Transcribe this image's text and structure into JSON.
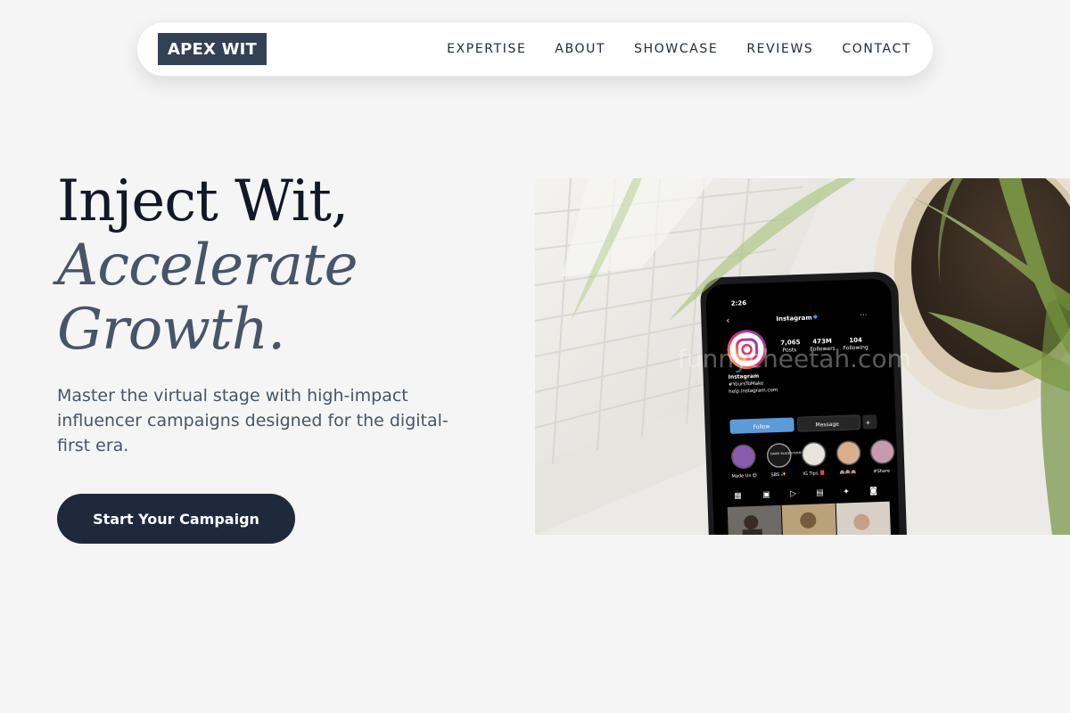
{
  "brand": {
    "logo_text": "APEX WIT"
  },
  "nav": {
    "links": [
      "EXPERTISE",
      "ABOUT",
      "SHOWCASE",
      "REVIEWS",
      "CONTACT"
    ]
  },
  "hero": {
    "title_line1": "Inject Wit,",
    "title_line2": "Accelerate",
    "title_line3": "Growth.",
    "subtitle": "Master the virtual stage with high-impact influencer campaigns designed for the digital-first era.",
    "cta_label": "Start Your Campaign"
  },
  "image": {
    "watermark": "funnycheetah.com",
    "phone": {
      "time": "2:26",
      "profile_name": "Instagram",
      "posts_count": "7,065",
      "posts_label": "Posts",
      "followers_count": "473M",
      "followers_label": "Followers",
      "following_count": "104",
      "following_label": "Following",
      "bio_name": "Instagram",
      "bio_tag": "#YoursToMake",
      "bio_link": "help.instagram.com",
      "follow_label": "Follow",
      "message_label": "Message",
      "highlights": [
        "Made Us 😊",
        "SBS ✨",
        "IG Tips 📕",
        "🙈🙈🙈",
        "#Share"
      ],
      "highlight_badge_text": "SHARE BLACK STORIES"
    }
  },
  "colors": {
    "page_bg": "#f5f5f5",
    "logo_bg": "#334155",
    "cta_bg": "#1e293b",
    "title_dark": "#111827",
    "title_accent": "#475569",
    "follow_button": "#5a9bd8"
  }
}
